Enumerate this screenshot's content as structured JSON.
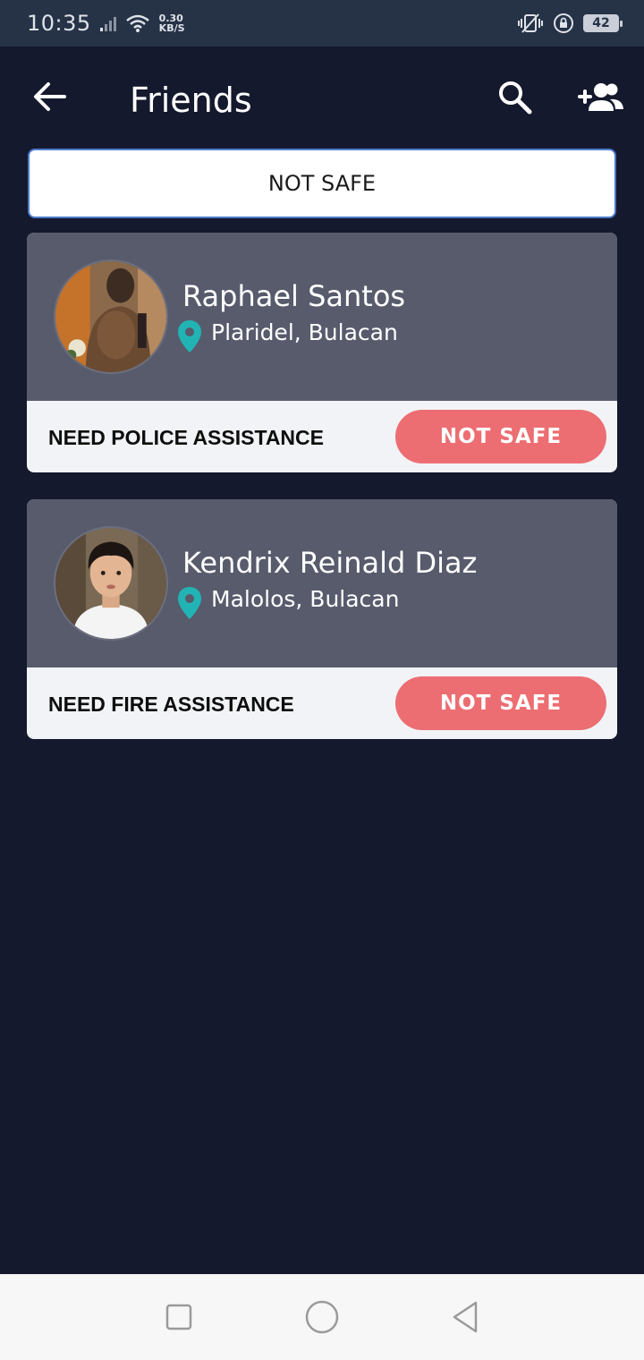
{
  "status_bar": {
    "time": "10:35",
    "speed_value": "0.30",
    "speed_unit": "KB/S",
    "battery": "42"
  },
  "app_bar": {
    "title": "Friends",
    "back_icon": "arrow-left-icon",
    "search_icon": "search-icon",
    "add_icon": "add-friend-icon"
  },
  "filter": {
    "label": "NOT SAFE"
  },
  "friends": [
    {
      "name": "Raphael Santos",
      "location": "Plaridel, Bulacan",
      "assistance": "NEED POLICE ASSISTANCE",
      "status": "NOT SAFE"
    },
    {
      "name": "Kendrix Reinald Diaz",
      "location": "Malolos, Bulacan",
      "assistance": "NEED FIRE ASSISTANCE",
      "status": "NOT SAFE"
    }
  ],
  "colors": {
    "background": "#15192d",
    "card_header": "#575b6c",
    "status_button": "#ec6e72",
    "pin": "#22b3b4",
    "filter_border": "#4a78c8"
  }
}
